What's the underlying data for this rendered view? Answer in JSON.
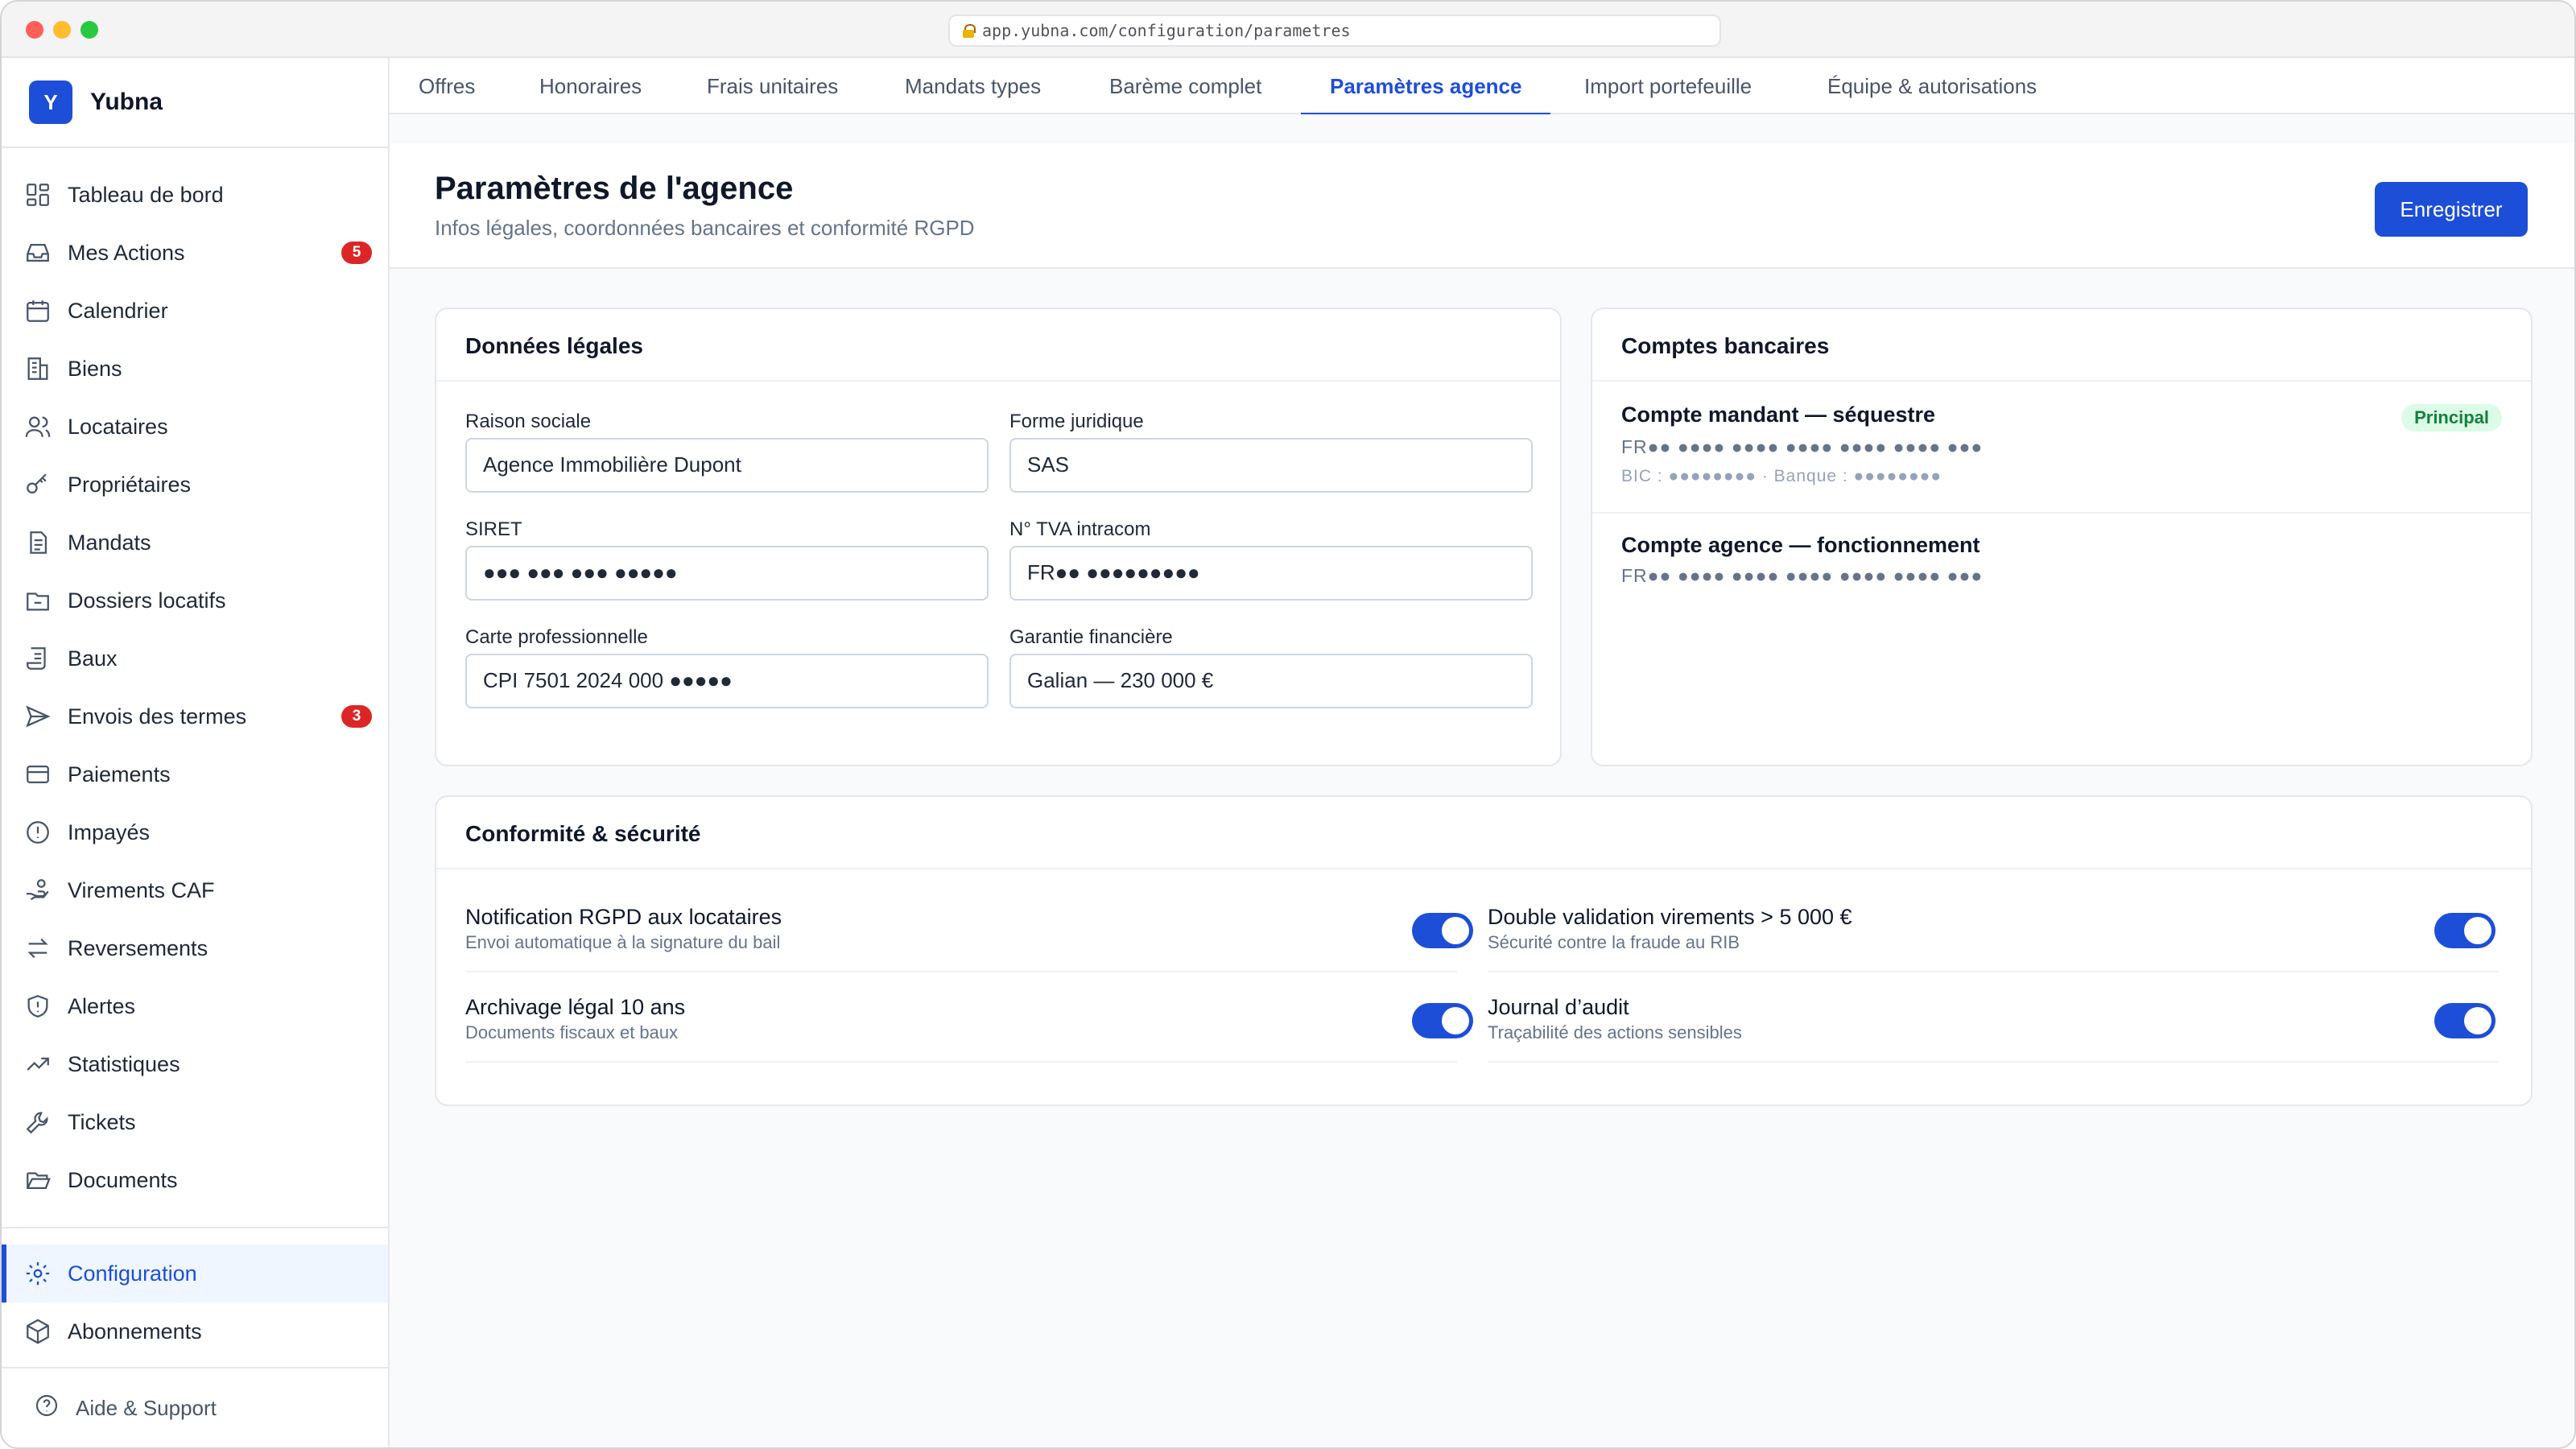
{
  "browser": {
    "url": "app.yubna.com/configuration/parametres"
  },
  "brand": {
    "logo_letter": "Y",
    "name": "Yubna"
  },
  "sidebar": {
    "items": [
      {
        "label": "Tableau de bord",
        "icon": "dashboard-icon"
      },
      {
        "label": "Mes Actions",
        "icon": "inbox-icon",
        "badge": "5"
      },
      {
        "label": "Calendrier",
        "icon": "calendar-icon"
      },
      {
        "label": "Biens",
        "icon": "building-icon"
      },
      {
        "label": "Locataires",
        "icon": "users-icon"
      },
      {
        "label": "Propriétaires",
        "icon": "key-icon"
      },
      {
        "label": "Mandats",
        "icon": "document-icon"
      },
      {
        "label": "Dossiers locatifs",
        "icon": "folder-icon"
      },
      {
        "label": "Baux",
        "icon": "scroll-icon"
      },
      {
        "label": "Envois des termes",
        "icon": "send-icon",
        "badge": "3"
      },
      {
        "label": "Paiements",
        "icon": "credit-card-icon"
      },
      {
        "label": "Impayés",
        "icon": "alert-circle-icon"
      },
      {
        "label": "Virements CAF",
        "icon": "hand-coins-icon"
      },
      {
        "label": "Reversements",
        "icon": "arrows-icon"
      },
      {
        "label": "Alertes",
        "icon": "shield-alert-icon"
      },
      {
        "label": "Statistiques",
        "icon": "trend-icon"
      },
      {
        "label": "Tickets",
        "icon": "wrench-icon"
      },
      {
        "label": "Documents",
        "icon": "folder-open-icon"
      }
    ],
    "bottom_items": [
      {
        "label": "Configuration",
        "icon": "gear-icon",
        "active": true
      },
      {
        "label": "Abonnements",
        "icon": "package-icon"
      }
    ],
    "help_label": "Aide & Support"
  },
  "tabs": [
    {
      "label": "Offres"
    },
    {
      "label": "Honoraires"
    },
    {
      "label": "Frais unitaires"
    },
    {
      "label": "Mandats types"
    },
    {
      "label": "Barème complet"
    },
    {
      "label": "Paramètres agence",
      "active": true
    },
    {
      "label": "Import portefeuille"
    },
    {
      "label": "Équipe & autorisations"
    }
  ],
  "header": {
    "title": "Paramètres de l'agence",
    "subtitle": "Infos légales, coordonnées bancaires et conformité RGPD",
    "save_label": "Enregistrer"
  },
  "legal": {
    "title": "Données légales",
    "fields": [
      {
        "label": "Raison sociale",
        "value": "Agence Immobilière Dupont"
      },
      {
        "label": "Forme juridique",
        "value": "SAS"
      },
      {
        "label": "SIRET",
        "value": "●●● ●●● ●●● ●●●●●"
      },
      {
        "label": "N° TVA intracom",
        "value": "FR●● ●●●●●●●●●"
      },
      {
        "label": "Carte professionnelle",
        "value": "CPI 7501 2024 000 ●●●●●"
      },
      {
        "label": "Garantie financière",
        "value": "Galian — 230 000 €"
      }
    ]
  },
  "banks": {
    "title": "Comptes bancaires",
    "accounts": [
      {
        "name": "Compte mandant — séquestre",
        "iban": "FR●● ●●●● ●●●● ●●●● ●●●● ●●●● ●●●",
        "meta": "BIC : ●●●●●●●● · Banque : ●●●●●●●●",
        "badge": "Principal"
      },
      {
        "name": "Compte agence — fonctionnement",
        "iban": "FR●● ●●●● ●●●● ●●●● ●●●● ●●●● ●●●"
      }
    ]
  },
  "compliance": {
    "title": "Conformité & sécurité",
    "toggles": [
      {
        "title": "Notification RGPD aux locataires",
        "desc": "Envoi automatique à la signature du bail",
        "on": true
      },
      {
        "title": "Double validation virements > 5 000 €",
        "desc": "Sécurité contre la fraude au RIB",
        "on": true
      },
      {
        "title": "Archivage légal 10 ans",
        "desc": "Documents fiscaux et baux",
        "on": true
      },
      {
        "title": "Journal d’audit",
        "desc": "Traçabilité des actions sensibles",
        "on": true
      }
    ]
  },
  "colors": {
    "accent": "#1d4ed8",
    "badge": "#dc2626",
    "success_bg": "#dcfce7",
    "success_text": "#15803d"
  }
}
